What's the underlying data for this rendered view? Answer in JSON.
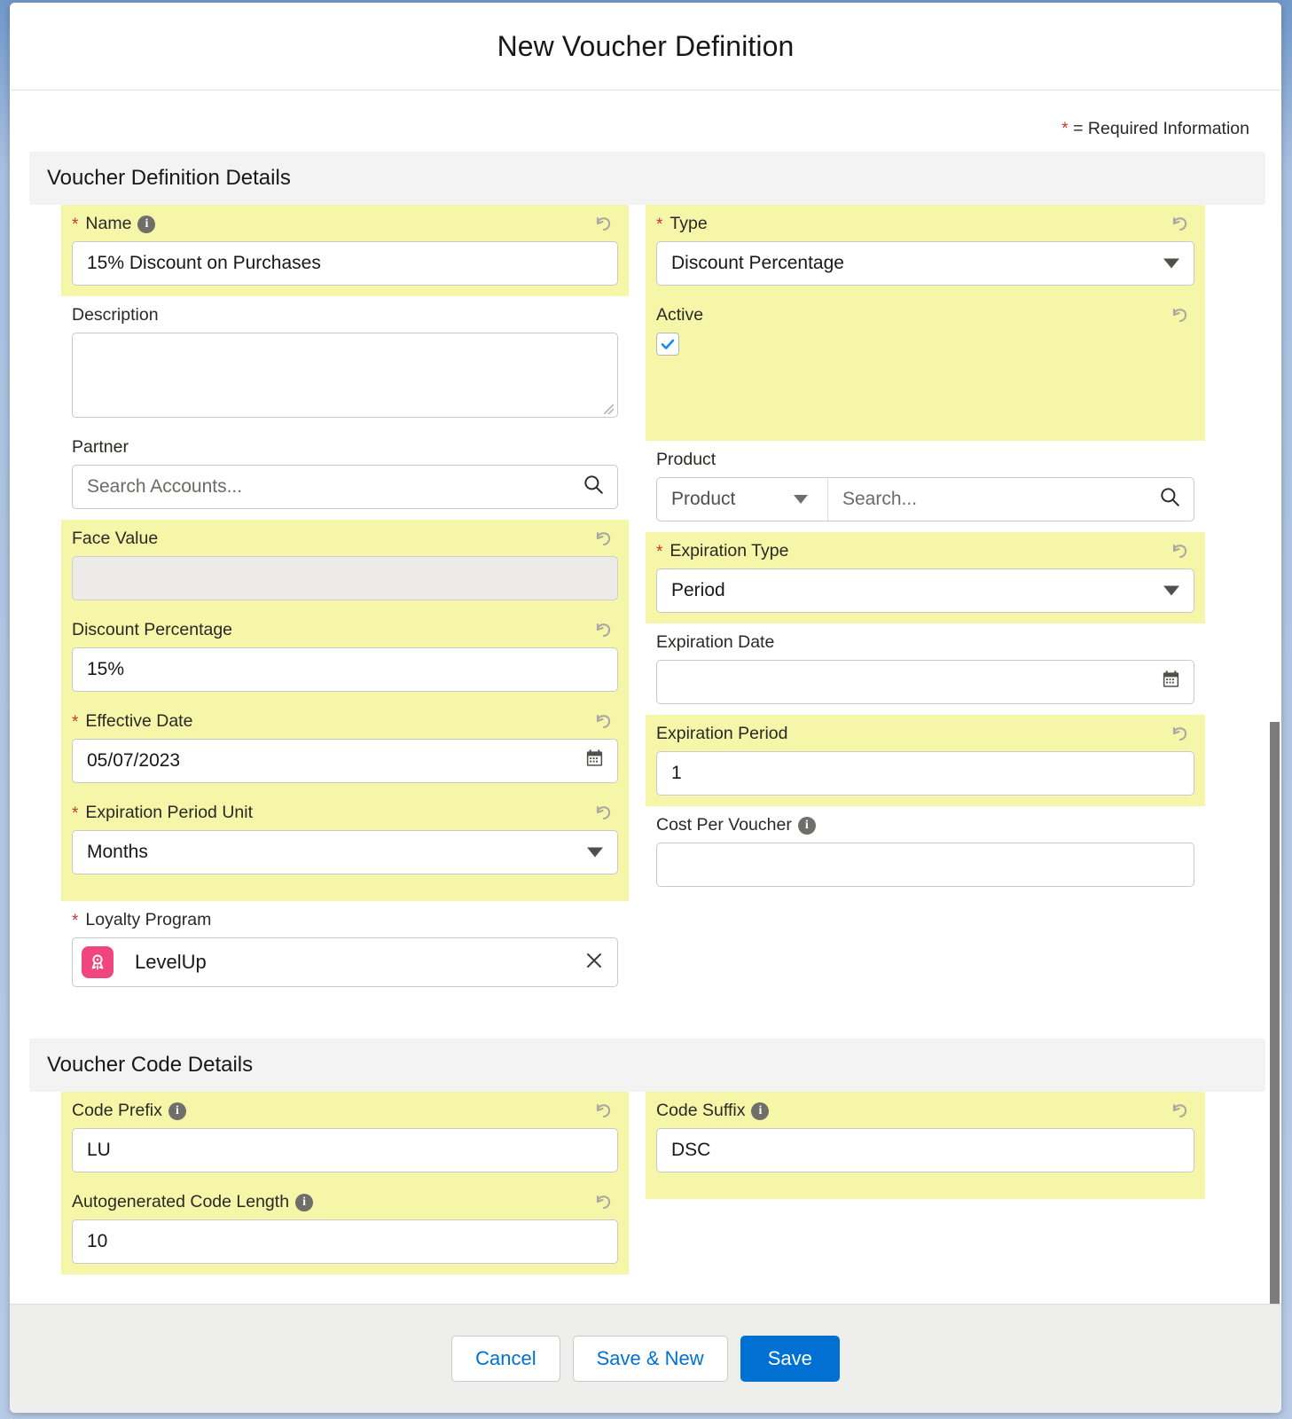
{
  "modal": {
    "title": "New Voucher Definition",
    "required_legend": "= Required Information",
    "required_star": "*"
  },
  "sections": {
    "details_heading": "Voucher Definition Details",
    "code_heading": "Voucher Code Details"
  },
  "fields": {
    "name": {
      "label": "Name",
      "value": "15% Discount on Purchases"
    },
    "description": {
      "label": "Description",
      "value": ""
    },
    "partner": {
      "label": "Partner",
      "placeholder": "Search Accounts..."
    },
    "face_value": {
      "label": "Face Value",
      "value": ""
    },
    "discount_percentage": {
      "label": "Discount Percentage",
      "value": "15%"
    },
    "effective_date": {
      "label": "Effective Date",
      "value": "05/07/2023"
    },
    "expiration_period_unit": {
      "label": "Expiration Period Unit",
      "value": "Months"
    },
    "loyalty_program": {
      "label": "Loyalty Program",
      "value": "LevelUp"
    },
    "type": {
      "label": "Type",
      "value": "Discount Percentage"
    },
    "active": {
      "label": "Active",
      "checked": true
    },
    "product": {
      "label": "Product",
      "object_value": "Product",
      "placeholder": "Search..."
    },
    "expiration_type": {
      "label": "Expiration Type",
      "value": "Period"
    },
    "expiration_date": {
      "label": "Expiration Date",
      "value": ""
    },
    "expiration_period": {
      "label": "Expiration Period",
      "value": "1"
    },
    "cost_per_voucher": {
      "label": "Cost Per Voucher",
      "value": ""
    },
    "code_prefix": {
      "label": "Code Prefix",
      "value": "LU"
    },
    "autogenerated_code_length": {
      "label": "Autogenerated Code Length",
      "value": "10"
    },
    "code_suffix": {
      "label": "Code Suffix",
      "value": "DSC"
    }
  },
  "footer": {
    "cancel": "Cancel",
    "save_new": "Save & New",
    "save": "Save"
  },
  "icons": {
    "info": "i",
    "undo": "undo-icon",
    "search": "search-icon",
    "calendar": "calendar-icon",
    "clear": "×",
    "loyalty_program_badge": "award-badge-icon",
    "dropdown": "chevron-down-icon",
    "checkmark": "check-icon"
  },
  "colors": {
    "highlight": "#f6f6a9",
    "required": "#c23934",
    "primary": "#0070d2",
    "loyalty_badge": "#f0467f",
    "section_header_bg": "#f3f3f3"
  }
}
